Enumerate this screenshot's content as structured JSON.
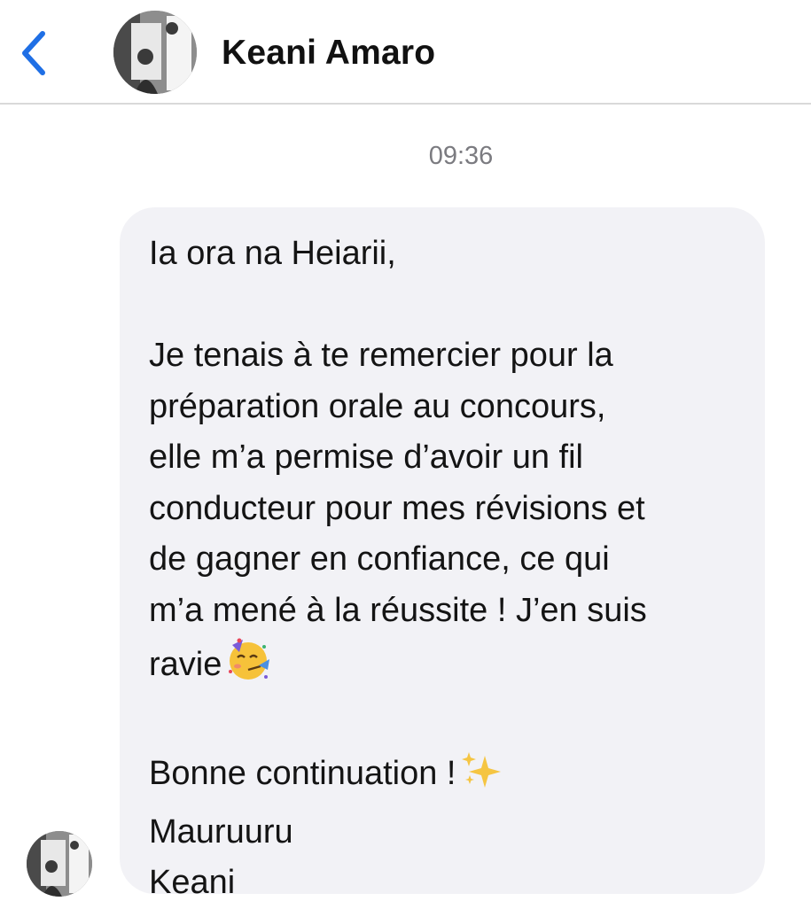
{
  "header": {
    "back_icon": "chevron-left-icon",
    "contact_name": "Keani Amaro",
    "accent_color": "#1f6fe5"
  },
  "conversation": {
    "timestamp": "09:36",
    "message": {
      "lines": [
        "Ia ora na Heiarii,",
        "",
        "Je tenais à te remercier pour la",
        "préparation orale au concours,",
        "elle m’a permise d’avoir un fil",
        "conducteur pour mes révisions et",
        "de gagner en confiance, ce qui",
        "m’a mené à la réussite ! J’en suis",
        "ravie",
        "",
        "Bonne continuation !",
        "Mauruuru",
        "Keani"
      ],
      "emojis": {
        "line_9": "partying-face-emoji",
        "line_11": "sparkles-emoji"
      },
      "bubble_color": "#f2f2f6"
    }
  }
}
